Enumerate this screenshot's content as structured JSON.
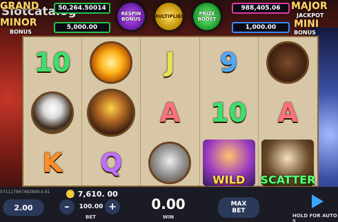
{
  "watermark": "Slotcatalog",
  "jackpots": {
    "grand": {
      "label": "GRAND",
      "value": "50,264.50014"
    },
    "minor": {
      "label": "MINOR",
      "sub": "BONUS",
      "value": "5,000.00"
    },
    "major": {
      "label": "MAJOR",
      "sub": "JACKPOT",
      "value": "988,405.06"
    },
    "mini": {
      "label": "MINI",
      "sub": "BONUS",
      "value": "1,000.00"
    }
  },
  "features": {
    "respin": "RESPIN BONUS",
    "multiplier": "MULTIPLIER",
    "prize_boost": "PRIZE BOOST"
  },
  "reels": [
    [
      {
        "t": "10",
        "c": "green"
      },
      {
        "t": "eagle",
        "k": "disc"
      },
      {
        "t": "K",
        "c": "orange"
      }
    ],
    [
      {
        "t": "fire",
        "k": "disc"
      },
      {
        "t": "chief",
        "k": "disc"
      },
      {
        "t": "Q",
        "c": "purple"
      }
    ],
    [
      {
        "t": "J",
        "c": "gold"
      },
      {
        "t": "A",
        "c": "red"
      },
      {
        "t": "wolf",
        "k": "disc"
      }
    ],
    [
      {
        "t": "9",
        "c": "blue"
      },
      {
        "t": "10",
        "c": "green"
      },
      {
        "t": "WILD",
        "k": "wild"
      }
    ],
    [
      {
        "t": "buffalo",
        "k": "disc"
      },
      {
        "t": "A",
        "c": "red"
      },
      {
        "t": "SCATTER",
        "k": "scatter"
      }
    ]
  ],
  "bottom": {
    "build": "071117967482899.0.61",
    "credit_icon": "coins-icon",
    "credit": "7,610. 00",
    "speed": "2.00",
    "minus": "–",
    "bet": "100.00",
    "bet_label": "BET",
    "plus": "+",
    "win": "0.00",
    "win_label": "WIN",
    "max_bet_1": "MAX",
    "max_bet_2": "BET",
    "hold_label": "HOLD FOR AUTO S",
    "play_icon": "play-icon"
  }
}
